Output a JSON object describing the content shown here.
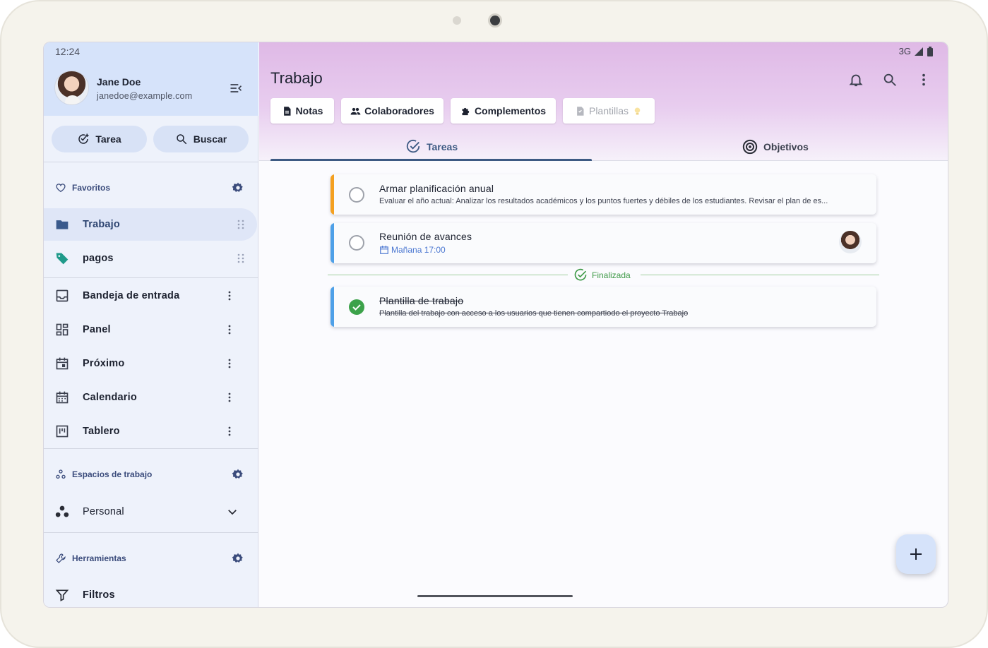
{
  "status": {
    "time": "12:24",
    "network": "3G"
  },
  "user": {
    "name": "Jane Doe",
    "email": "janedoe@example.com"
  },
  "quick_actions": {
    "task": "Tarea",
    "search": "Buscar"
  },
  "favorites": {
    "title": "Favoritos",
    "items": [
      {
        "label": "Trabajo",
        "color": "#3a5a8c"
      },
      {
        "label": "pagos",
        "color": "#1f9a8a"
      }
    ]
  },
  "nav": {
    "items": [
      {
        "label": "Bandeja de entrada"
      },
      {
        "label": "Panel"
      },
      {
        "label": "Próximo"
      },
      {
        "label": "Calendario"
      },
      {
        "label": "Tablero"
      }
    ]
  },
  "workspaces": {
    "title": "Espacios de trabajo",
    "items": [
      {
        "label": "Personal"
      }
    ]
  },
  "tools": {
    "title": "Herramientas",
    "items": [
      {
        "label": "Filtros"
      }
    ]
  },
  "header": {
    "title": "Trabajo"
  },
  "chips": {
    "notes": "Notas",
    "collaborators": "Colaboradores",
    "plugins": "Complementos",
    "templates": "Plantillas"
  },
  "tabs": {
    "tasks": "Tareas",
    "goals": "Objetivos"
  },
  "tasks": [
    {
      "title": "Armar planificación anual",
      "description": "Evaluar el año actual: Analizar los resultados académicos y los puntos fuertes y débiles de los estudiantes. Revisar el plan de es...",
      "accent": "#f4a020",
      "completed": false
    },
    {
      "title": "Reunión de avances",
      "due": "Mañana 17:00",
      "accent": "#4ea0e8",
      "completed": false
    }
  ],
  "finished_label": "Finalizada",
  "finished_tasks": [
    {
      "title": "Plantilla de trabajo",
      "description": "Plantilla del trabajo con acceso a los usuarios que tienen compartiodo el proyecto Trabajo",
      "accent": "#4ea0e8",
      "completed": true
    }
  ],
  "colors": {
    "accent": "#3d5a83",
    "success": "#3ca24a",
    "sidebar_header": "#d6e3fa"
  }
}
